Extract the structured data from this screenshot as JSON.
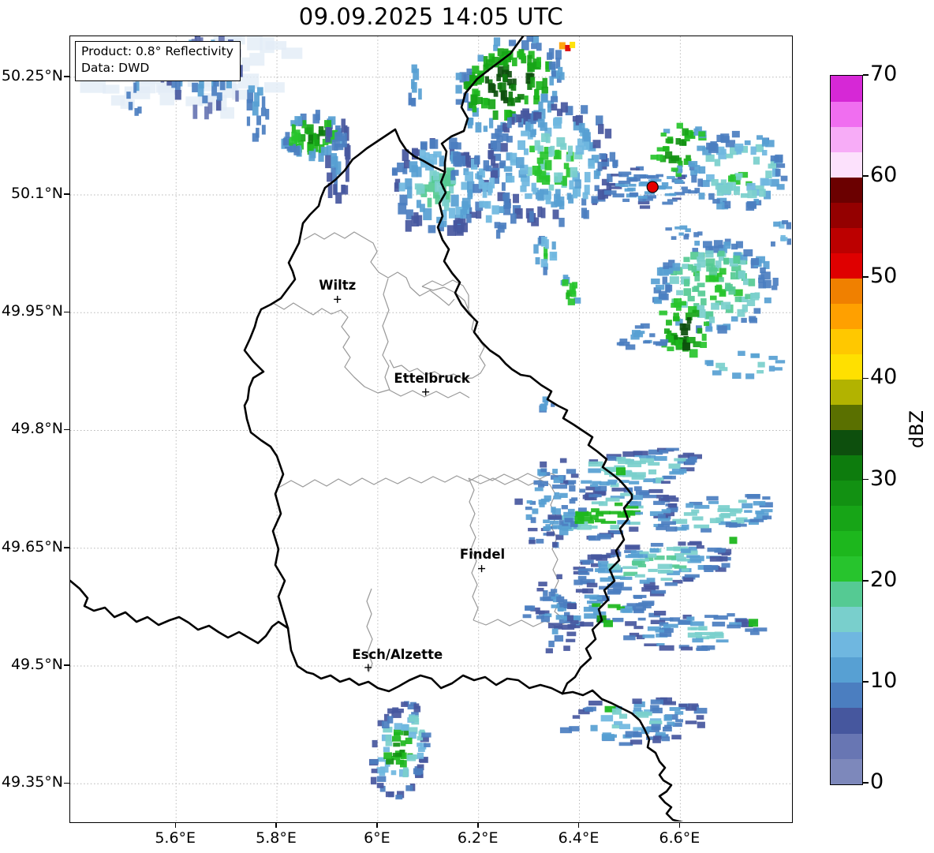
{
  "title": "09.09.2025 14:05 UTC",
  "info_box": {
    "line1": "Product: 0.8° Reflectivity",
    "line2": "Data: DWD"
  },
  "axes": {
    "lon_min": 5.39,
    "lon_max": 6.82,
    "lat_min": 49.302,
    "lat_max": 50.302,
    "x_ticks": [
      {
        "value": 5.6,
        "label": "5.6°E"
      },
      {
        "value": 5.8,
        "label": "5.8°E"
      },
      {
        "value": 6.0,
        "label": "6°E"
      },
      {
        "value": 6.2,
        "label": "6.2°E"
      },
      {
        "value": 6.4,
        "label": "6.4°E"
      },
      {
        "value": 6.6,
        "label": "6.6°E"
      }
    ],
    "y_ticks": [
      {
        "value": 50.25,
        "label": "50.25°N"
      },
      {
        "value": 50.1,
        "label": "50.1°N"
      },
      {
        "value": 49.95,
        "label": "49.95°N"
      },
      {
        "value": 49.8,
        "label": "49.8°N"
      },
      {
        "value": 49.65,
        "label": "49.65°N"
      },
      {
        "value": 49.5,
        "label": "49.5°N"
      },
      {
        "value": 49.35,
        "label": "49.35°N"
      }
    ]
  },
  "colorbar": {
    "label": "dBZ",
    "vmin": 0,
    "vmax": 70,
    "step": 2.5,
    "ticks": [
      {
        "value": 0,
        "label": "0"
      },
      {
        "value": 10,
        "label": "10"
      },
      {
        "value": 20,
        "label": "20"
      },
      {
        "value": 30,
        "label": "30"
      },
      {
        "value": 40,
        "label": "40"
      },
      {
        "value": 50,
        "label": "50"
      },
      {
        "value": 60,
        "label": "60"
      },
      {
        "value": 70,
        "label": "70"
      }
    ],
    "colors": [
      "#7D88BB",
      "#6876B3",
      "#46579E",
      "#4B7EC0",
      "#57A0D3",
      "#6FB7E0",
      "#79CFCC",
      "#55CA93",
      "#27C42D",
      "#1DB71D",
      "#17A517",
      "#129112",
      "#0D7C0D",
      "#0D4F0D",
      "#5A7000",
      "#B2B300",
      "#FFE000",
      "#FFC800",
      "#FFA000",
      "#F08000",
      "#DF0000",
      "#BC0000",
      "#940000",
      "#6B0000",
      "#FCE1FC",
      "#F7ACF7",
      "#F06EF0",
      "#D628D6"
    ]
  },
  "cities": [
    {
      "name": "Wiltz",
      "lon": 5.92,
      "lat": 49.967,
      "label_dx": 0,
      "label_dy": -8
    },
    {
      "name": "Ettelbruck",
      "lon": 6.095,
      "lat": 49.849,
      "label_dx": 8,
      "label_dy": -8
    },
    {
      "name": "Findel",
      "lon": 6.206,
      "lat": 49.624,
      "label_dx": 1,
      "label_dy": -9
    },
    {
      "name": "Esch/Alzette",
      "lon": 5.981,
      "lat": 49.498,
      "label_dx": 37,
      "label_dy": -7
    }
  ],
  "radar_site": {
    "lon": 6.545,
    "lat": 50.11,
    "color": "#E50000"
  },
  "chart_data": {
    "type": "heatmap",
    "title": "09.09.2025 14:05 UTC",
    "product": "0.8° Reflectivity",
    "source": "DWD",
    "units": "dBZ",
    "lon_range": [
      5.39,
      6.82
    ],
    "lat_range": [
      49.302,
      50.302
    ],
    "value_range": [
      0,
      70
    ],
    "level_step_dbz": 2.5,
    "legend_position": "right",
    "grid": "dotted",
    "pale_color": "#E2ECF6",
    "echo_clusters": [
      {
        "name": "nw-pale-wash",
        "lon": 5.643,
        "lat": 50.252,
        "rx": 0.218,
        "ry": 0.055,
        "rot": 0,
        "n": 45,
        "cell": [
          24,
          15
        ],
        "levels": {
          "outer": [
            "pale"
          ],
          "mid": [
            "pale"
          ],
          "core": [
            "pale"
          ]
        }
      },
      {
        "name": "nw-top-streaks",
        "lon": 5.655,
        "lat": 50.255,
        "rx": 0.086,
        "ry": 0.052,
        "rot": 0,
        "n": 55,
        "cell": [
          6,
          13
        ],
        "levels": {
          "outer": [
            1,
            2
          ],
          "mid": [
            3,
            4
          ],
          "core": [
            4,
            3
          ]
        }
      },
      {
        "name": "nw-streak-col",
        "lon": 5.76,
        "lat": 50.217,
        "rx": 0.022,
        "ry": 0.05,
        "rot": 0,
        "n": 14,
        "cell": [
          6,
          13
        ],
        "levels": {
          "outer": [
            3
          ],
          "mid": [
            3,
            4
          ],
          "core": [
            4
          ]
        }
      },
      {
        "name": "nw-tiny",
        "lon": 5.518,
        "lat": 50.222,
        "rx": 0.013,
        "ry": 0.026,
        "rot": 0,
        "n": 6,
        "cell": [
          5,
          12
        ],
        "levels": {
          "outer": [
            3
          ],
          "mid": [
            3,
            4
          ],
          "core": [
            4
          ]
        }
      },
      {
        "name": "nw-green-cell",
        "lon": 5.872,
        "lat": 50.175,
        "rx": 0.063,
        "ry": 0.028,
        "rot": 0,
        "n": 65,
        "cell": [
          7,
          11
        ],
        "levels": {
          "outer": [
            3,
            4
          ],
          "mid": [
            8,
            9
          ],
          "core": [
            10,
            12
          ]
        }
      },
      {
        "name": "col-streaks",
        "lon": 5.92,
        "lat": 50.147,
        "rx": 0.024,
        "ry": 0.052,
        "rot": 0,
        "n": 26,
        "cell": [
          6,
          14
        ],
        "levels": {
          "outer": [
            2
          ],
          "mid": [
            3
          ],
          "core": [
            4
          ]
        }
      },
      {
        "name": "north-center-mix",
        "lon": 6.12,
        "lat": 50.109,
        "rx": 0.097,
        "ry": 0.062,
        "rot": 0,
        "n": 120,
        "cell": [
          8,
          11
        ],
        "levels": {
          "outer": [
            2,
            3
          ],
          "mid": [
            4,
            5
          ],
          "core": [
            6,
            7
          ]
        }
      },
      {
        "name": "top-col",
        "lon": 6.075,
        "lat": 50.242,
        "rx": 0.016,
        "ry": 0.028,
        "rot": 0,
        "n": 8,
        "cell": [
          6,
          12
        ],
        "levels": {
          "outer": [
            3
          ],
          "mid": [
            3,
            4
          ],
          "core": [
            4
          ]
        }
      },
      {
        "name": "ne-strong-top",
        "lon": 6.259,
        "lat": 50.242,
        "rx": 0.117,
        "ry": 0.058,
        "rot": -25,
        "n": 150,
        "cell": [
          7,
          10
        ],
        "levels": {
          "outer": [
            3,
            4
          ],
          "mid": [
            9,
            10
          ],
          "core": [
            12,
            13
          ]
        }
      },
      {
        "name": "ne-mass",
        "lon": 6.347,
        "lat": 50.142,
        "rx": 0.125,
        "ry": 0.08,
        "rot": 20,
        "n": 190,
        "cell": [
          8,
          10
        ],
        "levels": {
          "outer": [
            2,
            3
          ],
          "mid": [
            4,
            5
          ],
          "core": [
            8,
            6
          ]
        }
      },
      {
        "name": "ne-diag-streaks",
        "lon": 6.207,
        "lat": 50.102,
        "rx": 0.044,
        "ry": 0.062,
        "rot": -35,
        "n": 40,
        "cell": [
          7,
          10
        ],
        "levels": {
          "outer": [
            3
          ],
          "mid": [
            4,
            5
          ],
          "core": [
            5
          ]
        }
      },
      {
        "name": "ne-bits",
        "lon": 6.335,
        "lat": 50.025,
        "rx": 0.023,
        "ry": 0.025,
        "rot": 0,
        "n": 14,
        "cell": [
          7,
          9
        ],
        "levels": {
          "outer": [
            3,
            4
          ],
          "mid": [
            5
          ],
          "core": [
            8
          ]
        }
      },
      {
        "name": "green-speck",
        "lon": 6.379,
        "lat": 49.976,
        "rx": 0.022,
        "ry": 0.018,
        "rot": 0,
        "n": 12,
        "cell": [
          7,
          9
        ],
        "levels": {
          "outer": [
            4
          ],
          "mid": [
            8
          ],
          "core": [
            9
          ]
        }
      },
      {
        "name": "radar-spokes",
        "lon": 6.545,
        "lat": 50.11,
        "rx": 0.09,
        "ry": 0.026,
        "rot": 0,
        "n": 60,
        "cell": [
          12,
          4
        ],
        "levels": {
          "outer": [
            2,
            3
          ],
          "mid": [
            3,
            4
          ],
          "core": [
            4
          ]
        }
      },
      {
        "name": "radar-ne-green",
        "lon": 6.597,
        "lat": 50.159,
        "rx": 0.041,
        "ry": 0.04,
        "rot": 35,
        "n": 34,
        "cell": [
          8,
          7
        ],
        "levels": {
          "outer": [
            4,
            8
          ],
          "mid": [
            9,
            10
          ],
          "core": [
            11
          ]
        }
      },
      {
        "name": "east-mass",
        "lon": 6.718,
        "lat": 50.129,
        "rx": 0.097,
        "ry": 0.05,
        "rot": 0,
        "n": 95,
        "cell": [
          9,
          8
        ],
        "levels": {
          "outer": [
            3,
            4
          ],
          "mid": [
            5,
            6
          ],
          "core": [
            6,
            8
          ]
        }
      },
      {
        "name": "specks-below-radar",
        "lon": 6.612,
        "lat": 50.055,
        "rx": 0.047,
        "ry": 0.014,
        "rot": 0,
        "n": 10,
        "cell": [
          8,
          5
        ],
        "levels": {
          "outer": [
            3
          ],
          "mid": [
            3,
            4
          ],
          "core": [
            4
          ]
        }
      },
      {
        "name": "edge-bits",
        "lon": 6.8,
        "lat": 50.051,
        "rx": 0.022,
        "ry": 0.02,
        "rot": 0,
        "n": 8,
        "cell": [
          8,
          7
        ],
        "levels": {
          "outer": [
            3
          ],
          "mid": [
            4,
            5
          ],
          "core": [
            5
          ]
        }
      },
      {
        "name": "east-mid-mass",
        "lon": 6.669,
        "lat": 49.984,
        "rx": 0.122,
        "ry": 0.058,
        "rot": 0,
        "n": 150,
        "cell": [
          9,
          8
        ],
        "levels": {
          "outer": [
            3,
            4
          ],
          "mid": [
            6,
            7
          ],
          "core": [
            7,
            8
          ]
        }
      },
      {
        "name": "east-mid-green-core",
        "lon": 6.606,
        "lat": 49.928,
        "rx": 0.05,
        "ry": 0.038,
        "rot": 0,
        "n": 45,
        "cell": [
          8,
          8
        ],
        "levels": {
          "outer": [
            8
          ],
          "mid": [
            9,
            10
          ],
          "core": [
            12,
            13
          ]
        }
      },
      {
        "name": "west-tail",
        "lon": 6.519,
        "lat": 49.918,
        "rx": 0.055,
        "ry": 0.016,
        "rot": 0,
        "n": 18,
        "cell": [
          10,
          5
        ],
        "levels": {
          "outer": [
            3
          ],
          "mid": [
            3,
            4
          ],
          "core": [
            4
          ]
        }
      },
      {
        "name": "lower-specks",
        "lon": 6.726,
        "lat": 49.884,
        "rx": 0.075,
        "ry": 0.016,
        "rot": 0,
        "n": 16,
        "cell": [
          9,
          6
        ],
        "levels": {
          "outer": [
            4
          ],
          "mid": [
            6
          ],
          "core": [
            8
          ]
        }
      },
      {
        "name": "tiny-west",
        "lon": 6.332,
        "lat": 49.834,
        "rx": 0.016,
        "ry": 0.013,
        "rot": 0,
        "n": 6,
        "cell": [
          7,
          7
        ],
        "levels": {
          "outer": [
            3
          ],
          "mid": [
            3,
            4
          ],
          "core": [
            4
          ]
        }
      },
      {
        "name": "band-1",
        "lon": 6.5,
        "lat": 49.748,
        "rx": 0.148,
        "ry": 0.026,
        "rot": -8,
        "n": 75,
        "cell": [
          14,
          5
        ],
        "levels": {
          "outer": [
            2,
            3
          ],
          "mid": [
            4,
            6
          ],
          "core": [
            6
          ]
        }
      },
      {
        "name": "band-2",
        "lon": 6.457,
        "lat": 49.694,
        "rx": 0.137,
        "ry": 0.03,
        "rot": -10,
        "n": 80,
        "cell": [
          14,
          5
        ],
        "levels": {
          "outer": [
            2,
            3
          ],
          "mid": [
            4,
            6
          ],
          "core": [
            9
          ]
        }
      },
      {
        "name": "band-3",
        "lon": 6.672,
        "lat": 49.694,
        "rx": 0.133,
        "ry": 0.022,
        "rot": -6,
        "n": 55,
        "cell": [
          14,
          5
        ],
        "levels": {
          "outer": [
            3,
            4
          ],
          "mid": [
            4,
            6
          ],
          "core": [
            6
          ]
        }
      },
      {
        "name": "band-4",
        "lon": 6.547,
        "lat": 49.628,
        "rx": 0.164,
        "ry": 0.028,
        "rot": -7,
        "n": 110,
        "cell": [
          14,
          5
        ],
        "levels": {
          "outer": [
            2,
            3
          ],
          "mid": [
            6,
            4
          ],
          "core": [
            7,
            6
          ]
        }
      },
      {
        "name": "band-5",
        "lon": 6.441,
        "lat": 49.574,
        "rx": 0.148,
        "ry": 0.026,
        "rot": -5,
        "n": 70,
        "cell": [
          14,
          5
        ],
        "levels": {
          "outer": [
            2,
            3
          ],
          "mid": [
            3,
            4
          ],
          "core": [
            9,
            4
          ]
        }
      },
      {
        "name": "band-6",
        "lon": 6.628,
        "lat": 49.543,
        "rx": 0.133,
        "ry": 0.024,
        "rot": -4,
        "n": 55,
        "cell": [
          14,
          5
        ],
        "levels": {
          "outer": [
            2,
            3
          ],
          "mid": [
            3,
            4
          ],
          "core": [
            6
          ]
        }
      },
      {
        "name": "border-patch",
        "lon": 6.344,
        "lat": 49.708,
        "rx": 0.065,
        "ry": 0.062,
        "rot": 0,
        "n": 55,
        "cell": [
          9,
          6
        ],
        "levels": {
          "outer": [
            2,
            3
          ],
          "mid": [
            3,
            4
          ],
          "core": [
            4
          ]
        }
      },
      {
        "name": "border-south-bits",
        "lon": 6.352,
        "lat": 49.566,
        "rx": 0.039,
        "ry": 0.055,
        "rot": 0,
        "n": 30,
        "cell": [
          9,
          6
        ],
        "levels": {
          "outer": [
            2
          ],
          "mid": [
            3
          ],
          "core": [
            4
          ]
        }
      },
      {
        "name": "south-cell",
        "lon": 6.045,
        "lat": 49.393,
        "rx": 0.059,
        "ry": 0.062,
        "rot": 12,
        "n": 90,
        "cell": [
          9,
          7
        ],
        "levels": {
          "outer": [
            2,
            3
          ],
          "mid": [
            5,
            6
          ],
          "core": [
            9,
            11
          ]
        }
      },
      {
        "name": "south-east-band",
        "lon": 6.508,
        "lat": 49.43,
        "rx": 0.143,
        "ry": 0.03,
        "rot": -3,
        "n": 70,
        "cell": [
          13,
          6
        ],
        "levels": {
          "outer": [
            2,
            3
          ],
          "mid": [
            3,
            4
          ],
          "core": [
            6,
            5
          ]
        }
      }
    ],
    "special_cells": [
      {
        "lon": 6.366,
        "lat": 50.29,
        "w": 8,
        "h": 9,
        "level": 18
      },
      {
        "lon": 6.377,
        "lat": 50.287,
        "w": 7,
        "h": 8,
        "level": 20
      },
      {
        "lon": 6.386,
        "lat": 50.291,
        "w": 7,
        "h": 8,
        "level": 16
      },
      {
        "lon": 6.482,
        "lat": 49.748,
        "w": 12,
        "h": 10,
        "level": 9
      },
      {
        "lon": 6.4,
        "lat": 49.686,
        "w": 12,
        "h": 10,
        "level": 9
      },
      {
        "lon": 6.444,
        "lat": 49.56,
        "w": 12,
        "h": 9,
        "level": 11
      },
      {
        "lon": 6.457,
        "lat": 49.554,
        "w": 12,
        "h": 9,
        "level": 9
      },
      {
        "lon": 6.461,
        "lat": 49.445,
        "w": 14,
        "h": 8,
        "level": 9
      },
      {
        "lon": 6.474,
        "lat": 49.442,
        "w": 12,
        "h": 8,
        "level": 6
      },
      {
        "lon": 6.705,
        "lat": 49.66,
        "w": 10,
        "h": 9,
        "level": 9
      },
      {
        "lon": 6.745,
        "lat": 49.555,
        "w": 12,
        "h": 10,
        "level": 9
      },
      {
        "lon": 6.612,
        "lat": 49.907,
        "w": 10,
        "h": 10,
        "level": 13
      }
    ]
  }
}
